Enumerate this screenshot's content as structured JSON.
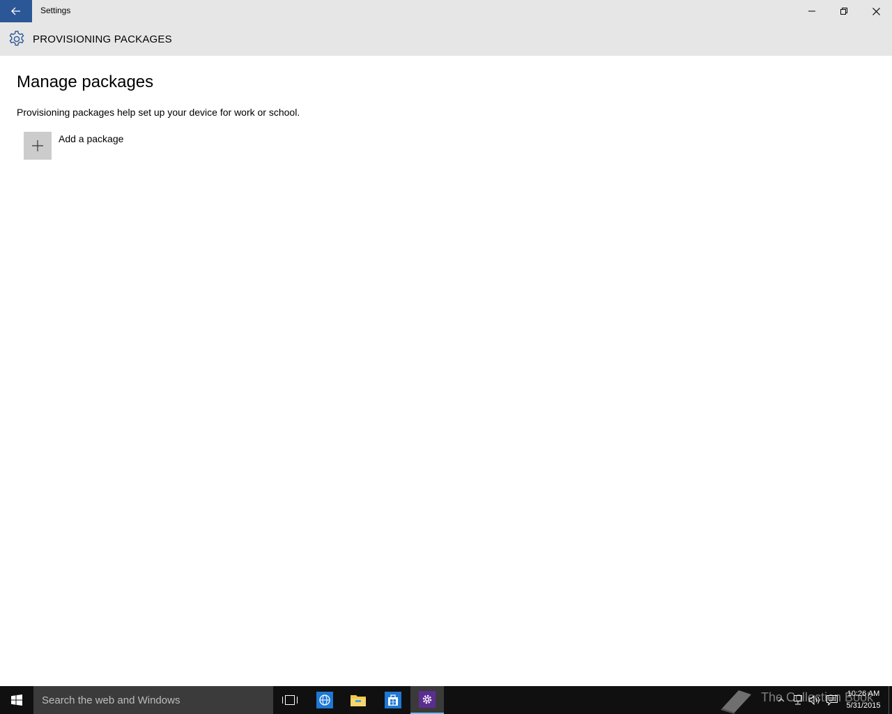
{
  "window": {
    "title": "Settings",
    "back_icon": "back-arrow-icon",
    "minimize_icon": "minimize-icon",
    "restore_icon": "restore-icon",
    "close_icon": "close-icon"
  },
  "header": {
    "icon": "gear-icon",
    "title": "PROVISIONING PACKAGES"
  },
  "main": {
    "page_title": "Manage packages",
    "description": "Provisioning packages help set up your device for work or school.",
    "add_package": {
      "icon": "plus-icon",
      "label": "Add a package"
    }
  },
  "taskbar": {
    "search_placeholder": "Search the web and Windows",
    "apps": [
      {
        "name": "task-view",
        "icon": "task-view-icon"
      },
      {
        "name": "internet-explorer",
        "icon": "ie-icon"
      },
      {
        "name": "file-explorer",
        "icon": "folder-icon"
      },
      {
        "name": "store",
        "icon": "store-icon"
      },
      {
        "name": "settings",
        "icon": "gear-icon",
        "active": true
      }
    ],
    "watermark": "The Collection Book",
    "clock": {
      "time": "10:26 AM",
      "date": "5/31/2015"
    }
  },
  "colors": {
    "accent": "#2b5797",
    "chrome": "#e6e6e6",
    "taskbar": "#101010",
    "settings_tile": "#5c2d91"
  }
}
